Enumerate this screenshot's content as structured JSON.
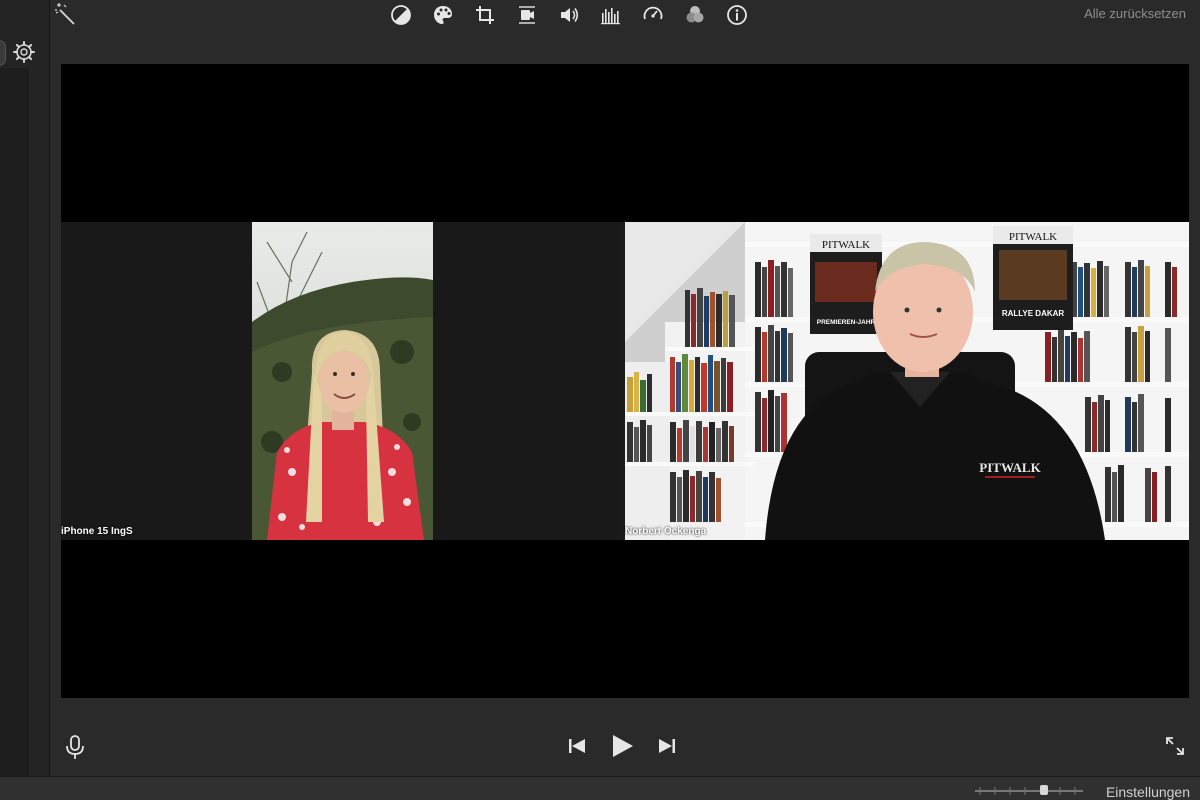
{
  "toolbar": {
    "icons": [
      "magic-wand-icon",
      "color-balance-icon",
      "color-palette-icon",
      "crop-icon",
      "stabilization-icon",
      "volume-icon",
      "equalizer-icon",
      "speed-icon",
      "filter-icon",
      "info-icon"
    ],
    "reset_label": "Alle zurücksetzen"
  },
  "viewer": {
    "participants": [
      {
        "name": "iPhone 15 IngS"
      },
      {
        "name": "Norbert Ockenga"
      }
    ]
  },
  "scene": {
    "banner_top": "PITWALK",
    "banner_right": "PITWALK",
    "book_title": "PREMIEREN-JAHR",
    "book_sub": "RALLYE DAKAR",
    "shirt_logo": "PITWALK"
  },
  "controls": {
    "settings_label": "Einstellungen"
  },
  "colors": {
    "app_bg": "#2a2a2a",
    "viewer_bg": "#000000",
    "icon": "#d8d8d8"
  }
}
